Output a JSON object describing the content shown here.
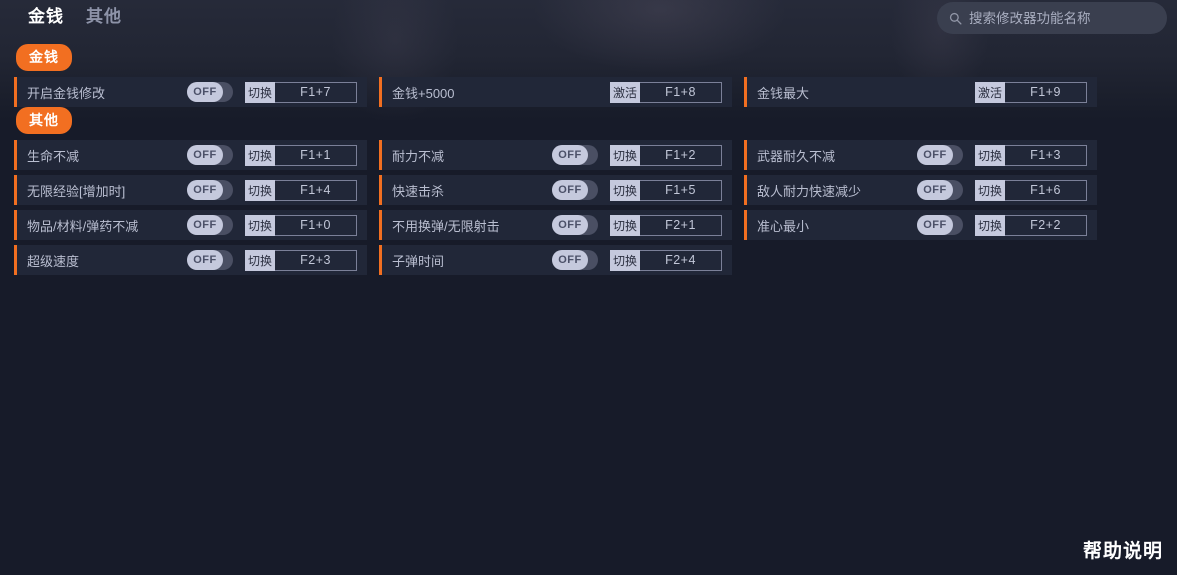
{
  "header": {
    "tabs": [
      {
        "label": "金钱",
        "active": true,
        "name": "tab-money"
      },
      {
        "label": "其他",
        "active": false,
        "name": "tab-other"
      }
    ],
    "search": {
      "placeholder": "搜索修改器功能名称",
      "value": "",
      "icon": "search-icon"
    }
  },
  "colors": {
    "accent": "#f26f21",
    "row_bg": "#212738",
    "page_bg": "#171b29",
    "toggle_knob": "#c5c9dd",
    "toggle_track": "#4a4f63",
    "text": "#b9bed0"
  },
  "groups": [
    {
      "title": "金钱",
      "name": "group-money",
      "rows": [
        {
          "label": "开启金钱修改",
          "control": "toggle",
          "state": "OFF",
          "action": "切换",
          "hotkey": "F1+7"
        },
        {
          "label": "金钱+5000",
          "control": "none",
          "state": "",
          "action": "激活",
          "hotkey": "F1+8"
        },
        {
          "label": "金钱最大",
          "control": "none",
          "state": "",
          "action": "激活",
          "hotkey": "F1+9"
        }
      ]
    },
    {
      "title": "其他",
      "name": "group-other",
      "rows": [
        {
          "label": "生命不减",
          "control": "toggle",
          "state": "OFF",
          "action": "切换",
          "hotkey": "F1+1"
        },
        {
          "label": "耐力不减",
          "control": "toggle",
          "state": "OFF",
          "action": "切换",
          "hotkey": "F1+2"
        },
        {
          "label": "武器耐久不减",
          "control": "toggle",
          "state": "OFF",
          "action": "切换",
          "hotkey": "F1+3"
        },
        {
          "label": "无限经验[增加时]",
          "control": "toggle",
          "state": "OFF",
          "action": "切换",
          "hotkey": "F1+4"
        },
        {
          "label": "快速击杀",
          "control": "toggle",
          "state": "OFF",
          "action": "切换",
          "hotkey": "F1+5"
        },
        {
          "label": "敌人耐力快速减少",
          "control": "toggle",
          "state": "OFF",
          "action": "切换",
          "hotkey": "F1+6"
        },
        {
          "label": "物品/材料/弹药不减",
          "control": "toggle",
          "state": "OFF",
          "action": "切换",
          "hotkey": "F1+0"
        },
        {
          "label": "不用换弹/无限射击",
          "control": "toggle",
          "state": "OFF",
          "action": "切换",
          "hotkey": "F2+1"
        },
        {
          "label": "准心最小",
          "control": "toggle",
          "state": "OFF",
          "action": "切换",
          "hotkey": "F2+2"
        },
        {
          "label": "超级速度",
          "control": "toggle",
          "state": "OFF",
          "action": "切换",
          "hotkey": "F2+3"
        },
        {
          "label": "子弹时间",
          "control": "toggle",
          "state": "OFF",
          "action": "切换",
          "hotkey": "F2+4"
        }
      ]
    }
  ],
  "footer": {
    "help_label": "帮助说明"
  }
}
